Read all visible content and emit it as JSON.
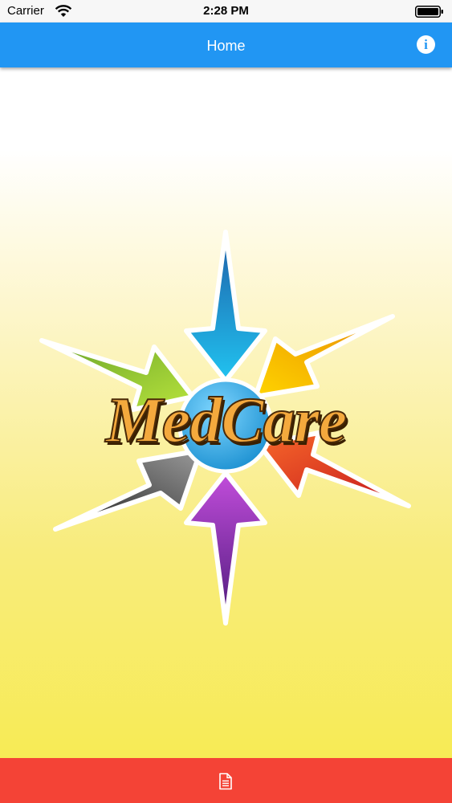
{
  "status_bar": {
    "carrier": "Carrier",
    "time": "2:28 PM",
    "wifi_icon": "wifi-icon",
    "battery_icon": "battery-icon"
  },
  "nav": {
    "title": "Home",
    "info_glyph": "i",
    "info_icon": "info-icon"
  },
  "logo": {
    "text": "MedCare",
    "arrow_colors": {
      "top": "#1ab0e8",
      "upper_right": "#f5b200",
      "lower_right": "#e8401c",
      "bottom": "#9b3fc6",
      "lower_left": "#4a4a4a",
      "upper_left": "#8cc63f",
      "center": "#2aa3dc"
    }
  },
  "tab_bar": {
    "document_icon": "document-icon",
    "color": "#f44336"
  },
  "colors": {
    "nav_bar": "#2196f3",
    "text_fill": "#f4a93d"
  }
}
